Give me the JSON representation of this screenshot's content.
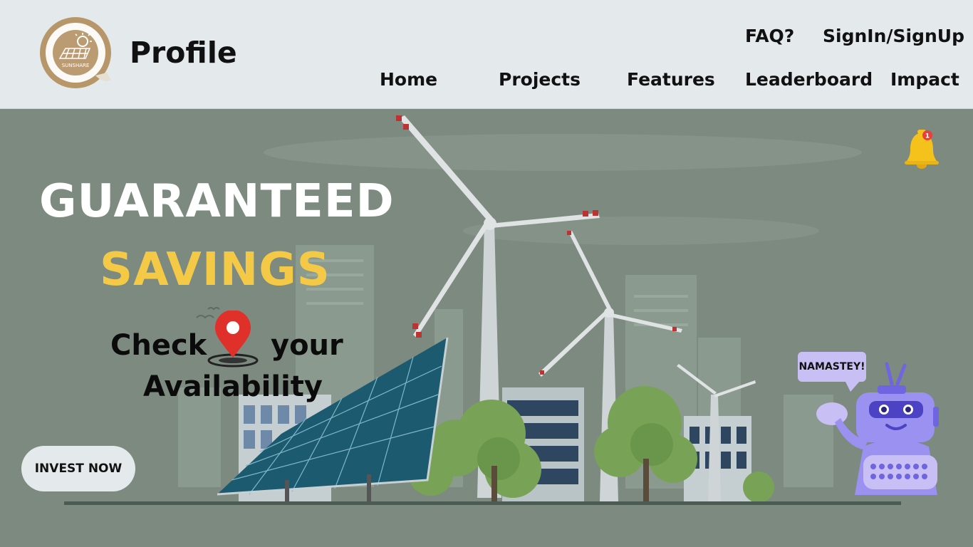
{
  "header": {
    "title": "Profile",
    "logo_text": "SUNSHARE",
    "top_links": [
      "FAQ?",
      "SignIn/SignUp"
    ],
    "nav": [
      "Home",
      "Projects",
      "Features",
      "Leaderboard",
      "Impact"
    ]
  },
  "hero": {
    "headline_1": "GUARANTEED",
    "headline_2": "SAVINGS",
    "check_word": "Check",
    "your_word": "your",
    "availability_word": "Availability",
    "cta_label": "INVEST NOW",
    "notification_count": "1",
    "bot_greeting": "NAMASTEY!"
  },
  "colors": {
    "header_bg": "#e4eaec",
    "hero_bg": "#7d8a80",
    "accent_yellow": "#f4c945",
    "pin_red": "#e0302a",
    "bot_purple": "#8d84ee"
  }
}
